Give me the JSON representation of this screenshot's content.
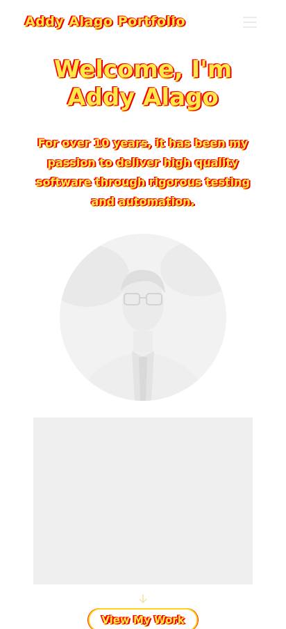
{
  "nav": {
    "brand": "Addy Alago Portfolio",
    "menu_icon": "hamburger-menu-icon"
  },
  "hero": {
    "title_line1": "Welcome, I'm",
    "title_line2": "Addy Alago",
    "intro": "For over 10 years, it has been my passion to deliver high quality software through rigorous testing and automation."
  },
  "profile": {
    "avatar_alt": "profile-photo",
    "arrow_icon": "arrow-down-icon"
  },
  "cta": {
    "label": "View My Work"
  },
  "colors": {
    "text_fill": "#ffe94a",
    "text_edge": "#ff0000",
    "media_bg": "#efefef",
    "button_border": "#ffd21a"
  }
}
